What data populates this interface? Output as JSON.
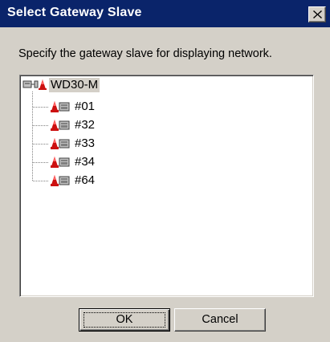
{
  "window": {
    "title": "Select Gateway Slave",
    "instruction": "Specify the gateway slave for displaying network."
  },
  "tree": {
    "root": {
      "label": "WD30-M",
      "icon": "network-master-icon",
      "selected": true
    },
    "children": [
      {
        "label": "#01",
        "icon": "gateway-slave-icon"
      },
      {
        "label": "#32",
        "icon": "gateway-slave-icon"
      },
      {
        "label": "#33",
        "icon": "gateway-slave-icon"
      },
      {
        "label": "#34",
        "icon": "gateway-slave-icon"
      },
      {
        "label": "#64",
        "icon": "gateway-slave-icon"
      }
    ]
  },
  "buttons": {
    "ok_label": "OK",
    "cancel_label": "Cancel"
  },
  "colors": {
    "titlebar": "#0a246a",
    "face": "#d4d0c8",
    "icon_red": "#cc1010"
  }
}
